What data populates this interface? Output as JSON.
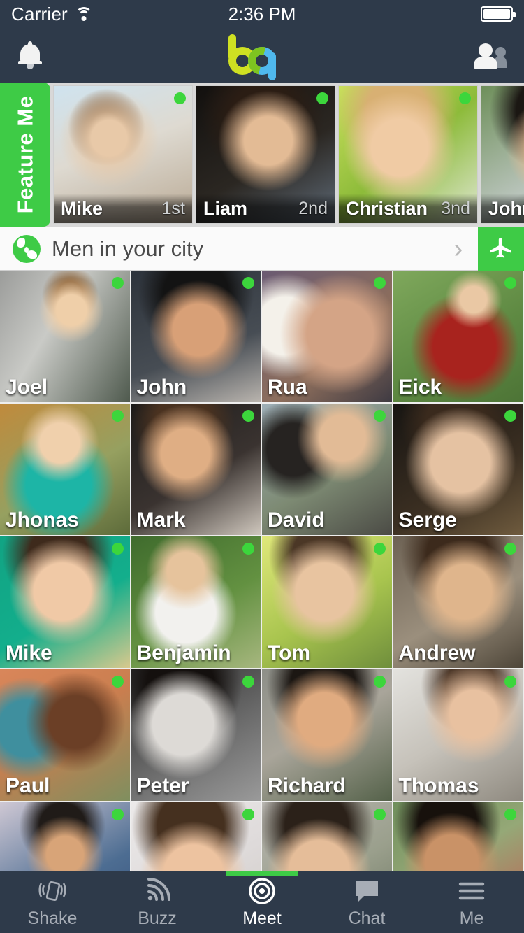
{
  "status_bar": {
    "carrier": "Carrier",
    "time": "2:36 PM",
    "wifi_icon": "wifi-icon",
    "battery_icon": "battery-full-icon"
  },
  "nav_bar": {
    "notifications_icon": "bell-icon",
    "logo_b": "b",
    "logo_q": "q",
    "logo_name": "bq-logo",
    "friends_icon": "people-icon"
  },
  "featured": {
    "feature_me_label": "Feature Me",
    "cards": [
      {
        "name": "Mike",
        "rank": "1st",
        "online": true
      },
      {
        "name": "Liam",
        "rank": "2nd",
        "online": true
      },
      {
        "name": "Christian",
        "rank": "3nd",
        "online": true
      },
      {
        "name": "John",
        "rank": "",
        "online": false
      }
    ]
  },
  "location_bar": {
    "globe_icon": "globe-icon",
    "label": "Men in your city",
    "chevron": "›",
    "travel_icon": "airplane-icon"
  },
  "grid": {
    "rows": [
      [
        {
          "name": "Joel",
          "online": true
        },
        {
          "name": "John",
          "online": true
        },
        {
          "name": "Rua",
          "online": true
        },
        {
          "name": "Eick",
          "online": true
        }
      ],
      [
        {
          "name": "Jhonas",
          "online": true
        },
        {
          "name": "Mark",
          "online": true
        },
        {
          "name": "David",
          "online": true
        },
        {
          "name": "Serge",
          "online": true
        }
      ],
      [
        {
          "name": "Mike",
          "online": true
        },
        {
          "name": "Benjamin",
          "online": true
        },
        {
          "name": "Tom",
          "online": true
        },
        {
          "name": "Andrew",
          "online": true
        }
      ],
      [
        {
          "name": "Paul",
          "online": true
        },
        {
          "name": "Peter",
          "online": true
        },
        {
          "name": "Richard",
          "online": true
        },
        {
          "name": "Thomas",
          "online": true
        }
      ],
      [
        {
          "name": "",
          "online": true
        },
        {
          "name": "",
          "online": true
        },
        {
          "name": "",
          "online": true
        },
        {
          "name": "",
          "online": true
        }
      ]
    ]
  },
  "tab_bar": {
    "tabs": [
      {
        "label": "Shake",
        "icon": "shake-phone-icon",
        "active": false
      },
      {
        "label": "Buzz",
        "icon": "rss-waves-icon",
        "active": false
      },
      {
        "label": "Meet",
        "icon": "target-icon",
        "active": true
      },
      {
        "label": "Chat",
        "icon": "speech-bubble-icon",
        "active": false
      },
      {
        "label": "Me",
        "icon": "hamburger-menu-icon",
        "active": false
      }
    ]
  },
  "colors": {
    "accent_green": "#3ecb46",
    "online_dot": "#3cd63c",
    "navbar": "#2e3a4a",
    "logo_yellow": "#cfe022",
    "logo_blue": "#4fb8ee"
  }
}
